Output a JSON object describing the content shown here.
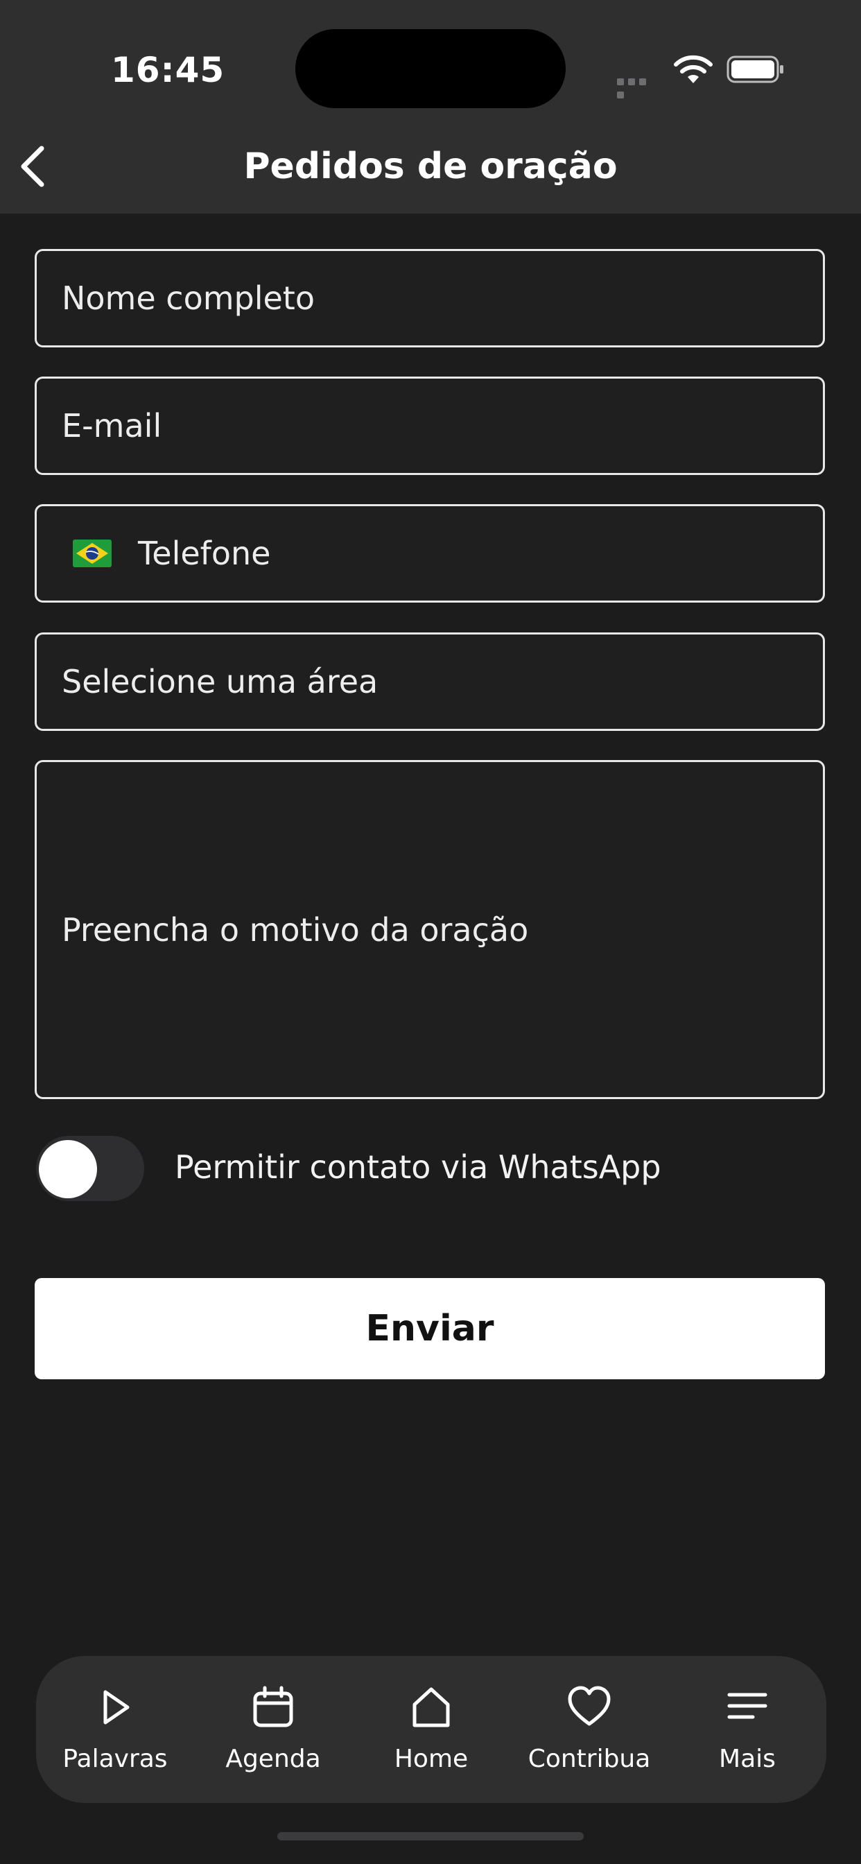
{
  "status_bar": {
    "time": "16:45"
  },
  "header": {
    "title": "Pedidos de oração"
  },
  "form": {
    "name_placeholder": "Nome completo",
    "email_placeholder": "E-mail",
    "phone_placeholder": "Telefone",
    "area_placeholder": "Selecione uma área",
    "reason_placeholder": "Preencha o motivo da oração",
    "whatsapp_label": "Permitir contato via WhatsApp",
    "whatsapp_enabled": false,
    "submit_label": "Enviar"
  },
  "tabbar": {
    "items": [
      {
        "label": "Palavras",
        "icon": "play-icon"
      },
      {
        "label": "Agenda",
        "icon": "calendar-icon"
      },
      {
        "label": "Home",
        "icon": "home-icon"
      },
      {
        "label": "Contribua",
        "icon": "heart-icon"
      },
      {
        "label": "Mais",
        "icon": "menu-icon"
      }
    ]
  }
}
